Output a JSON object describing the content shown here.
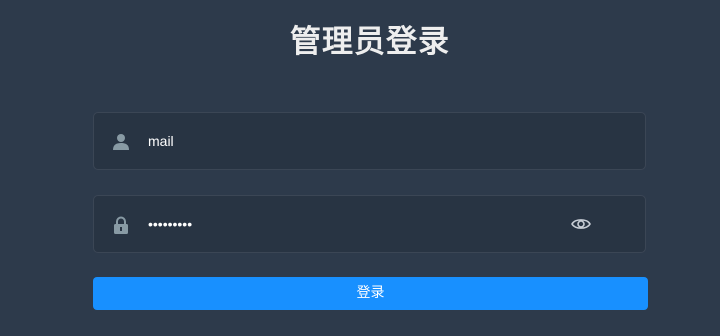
{
  "page": {
    "title": "管理员登录"
  },
  "username": {
    "icon": "user-icon",
    "value": "mail"
  },
  "password": {
    "icon": "lock-icon",
    "value": "•••••••••",
    "toggle_icon": "eye-icon"
  },
  "login_button": {
    "label": "登录",
    "color": "#1890ff"
  },
  "colors": {
    "background": "#2d3a4b",
    "field_background": "#283443",
    "icon": "#889aa4"
  }
}
